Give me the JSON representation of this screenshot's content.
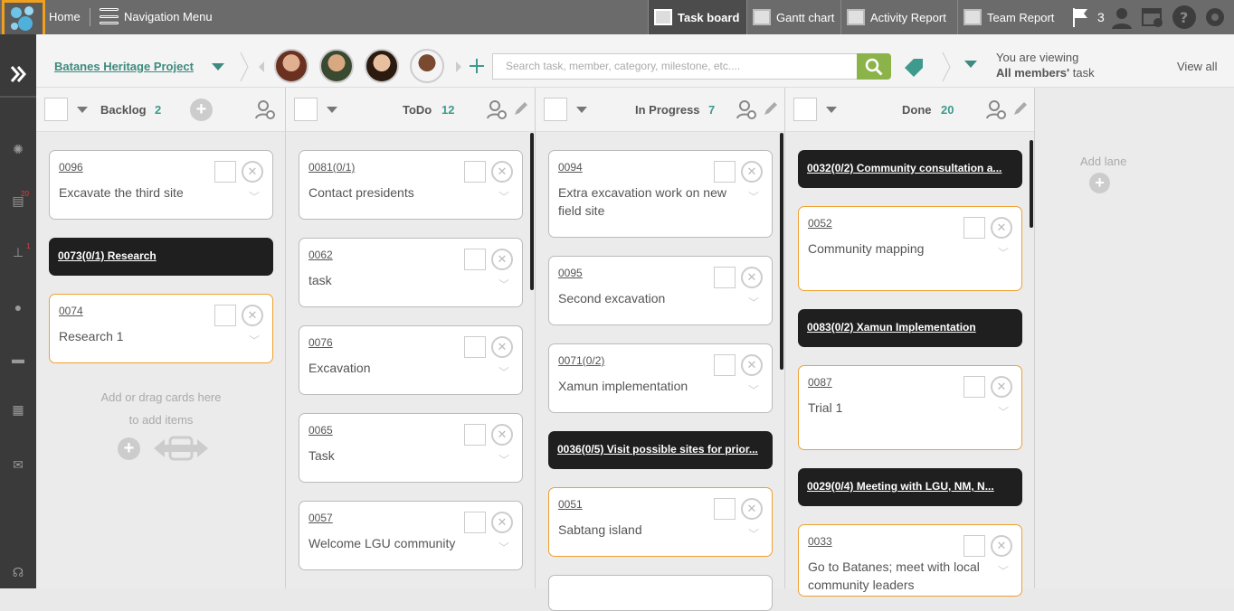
{
  "topbar": {
    "home": "Home",
    "nav_menu": "Navigation Menu",
    "tabs": {
      "task_board": "Task board",
      "gantt": "Gantt chart",
      "activity": "Activity Report",
      "team": "Team Report"
    },
    "flag_count": "3"
  },
  "rail": {
    "badge_tasks": "20",
    "badge_stamp": "1"
  },
  "subheader": {
    "project": "Batanes Heritage Project",
    "search_placeholder": "Search task, member, category, milestone, etc....",
    "viewing_line1": "You are viewing",
    "viewing_members": "All members'",
    "viewing_task": " task",
    "view_all": "View all"
  },
  "lanes": {
    "backlog": {
      "title": "Backlog",
      "count": "2"
    },
    "todo": {
      "title": "ToDo",
      "count": "12"
    },
    "inprogress": {
      "title": "In Progress",
      "count": "7"
    },
    "done": {
      "title": "Done",
      "count": "20"
    },
    "add_lane": "Add lane"
  },
  "backlog_cards": {
    "c1": {
      "id": "0096",
      "title": "Excavate the third site"
    },
    "b1": "0073(0/1) Research",
    "c2": {
      "id": "0074",
      "title": "Research 1"
    },
    "add_line1": "Add or drag cards here",
    "add_line2": "to add items"
  },
  "todo_cards": {
    "c1": {
      "id": "0081(0/1)",
      "title": "Contact presidents"
    },
    "c2": {
      "id": "0062",
      "title": "task"
    },
    "c3": {
      "id": "0076",
      "title": "Excavation"
    },
    "c4": {
      "id": "0065",
      "title": "Task"
    },
    "c5": {
      "id": "0057",
      "title": "Welcome LGU community"
    }
  },
  "progress_cards": {
    "c1": {
      "id": "0094",
      "title": "Extra excavation work on new field site"
    },
    "c2": {
      "id": "0095",
      "title": "Second excavation"
    },
    "c3": {
      "id": "0071(0/2)",
      "title": "Xamun implementation"
    },
    "b1": "0036(0/5) Visit possible sites for prior...",
    "c4": {
      "id": "0051",
      "title": "Sabtang island"
    }
  },
  "done_cards": {
    "b1": "0032(0/2) Community consultation a...",
    "c1": {
      "id": "0052",
      "title": "Community mapping"
    },
    "b2": "0083(0/2) Xamun Implementation",
    "c2": {
      "id": "0087",
      "title": "Trial 1"
    },
    "b3": "0029(0/4) Meeting with LGU, NM, N...",
    "c3": {
      "id": "0033",
      "title": "Go to Batanes; meet with local community leaders"
    }
  },
  "colors": {
    "accent": "#3e9a8c",
    "orange": "#f0a030",
    "search_green": "#8cb34a",
    "topbar": "#6b6b6b"
  }
}
